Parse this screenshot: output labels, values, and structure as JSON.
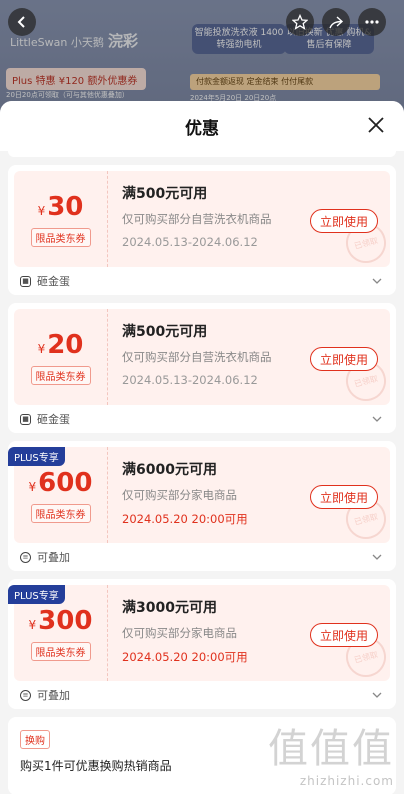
{
  "background": {
    "brand_left": "LittleSwan 小天鹅",
    "brand_right": "浣彩",
    "banner1": "智能投放洗衣液 1400转强劲电机",
    "banner2": "以旧换新 优惠 购机&售后有保障",
    "plus_row": "Plus 特惠 ¥120 额外优惠券",
    "plus_sub": "20日20点可领取（可与其他优惠叠加）",
    "flow": "付款金额返现    定金结束    付付尾款",
    "flow_dates": "2024年5月20日  20日20点"
  },
  "sheet": {
    "title": "优惠"
  },
  "coupons": [
    {
      "currency": "¥",
      "amount": "30",
      "category_tag": "限品类东券",
      "condition": "满500元可用",
      "description": "仅可购买部分自营洗衣机商品",
      "date": "2024.05.13-2024.06.12",
      "date_highlight": false,
      "button": "立即使用",
      "plus": false,
      "footer": "砸金蛋",
      "stamp": "已领取"
    },
    {
      "currency": "¥",
      "amount": "20",
      "category_tag": "限品类东券",
      "condition": "满500元可用",
      "description": "仅可购买部分自营洗衣机商品",
      "date": "2024.05.13-2024.06.12",
      "date_highlight": false,
      "button": "立即使用",
      "plus": false,
      "footer": "砸金蛋",
      "stamp": "已领取"
    },
    {
      "currency": "¥",
      "amount": "600",
      "category_tag": "限品类东券",
      "condition": "满6000元可用",
      "description": "仅可购买部分家电商品",
      "date": "2024.05.20 20:00可用",
      "date_highlight": true,
      "button": "立即使用",
      "plus": true,
      "plus_label": "PLUS专享",
      "footer": "可叠加",
      "stamp": "已领取"
    },
    {
      "currency": "¥",
      "amount": "300",
      "category_tag": "限品类东券",
      "condition": "满3000元可用",
      "description": "仅可购买部分家电商品",
      "date": "2024.05.20 20:00可用",
      "date_highlight": true,
      "button": "立即使用",
      "plus": true,
      "plus_label": "PLUS专享",
      "footer": "可叠加",
      "stamp": "已领取"
    }
  ],
  "exchange": {
    "tag": "换购",
    "text": "购买1件可优惠换购热销商品"
  },
  "watermark": {
    "chars": "值值值",
    "url": "zhizhizhi.com"
  },
  "colors": {
    "accent": "#e0311d",
    "plus_badge": "#243e9a",
    "coupon_bg": "#fff1ee"
  }
}
